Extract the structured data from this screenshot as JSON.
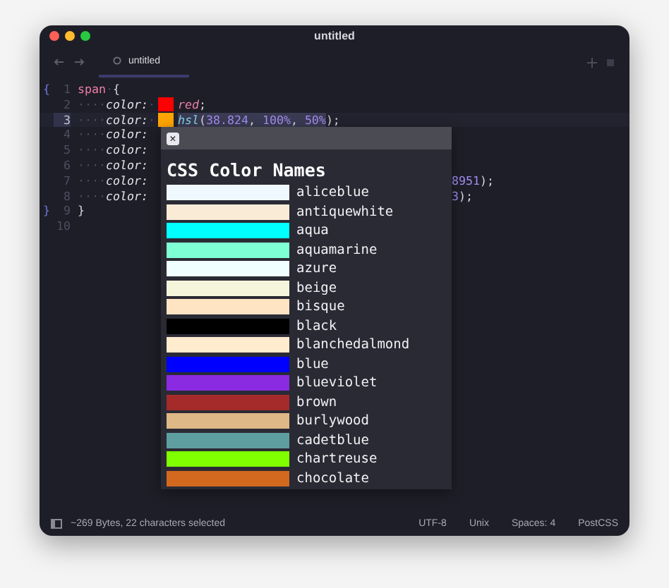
{
  "window": {
    "title": "untitled"
  },
  "tabs": [
    {
      "label": "untitled",
      "selected": true
    }
  ],
  "editor": {
    "lines": [
      {
        "number": "1",
        "fold": "{",
        "current": false,
        "tokens": [
          {
            "kind": "selector",
            "text": "span"
          },
          {
            "kind": "space",
            "text": "·"
          },
          {
            "kind": "punct",
            "text": "{"
          }
        ]
      },
      {
        "number": "2",
        "current": false,
        "tokens": [
          {
            "kind": "space",
            "text": "····"
          },
          {
            "kind": "property",
            "text": "color:"
          },
          {
            "kind": "space",
            "text": "·"
          },
          {
            "kind": "swatch",
            "color": "#ff0000"
          },
          {
            "kind": "value",
            "text": "red"
          },
          {
            "kind": "punct",
            "text": ";"
          }
        ]
      },
      {
        "number": "3",
        "current": true,
        "tokens": [
          {
            "kind": "space",
            "text": "····"
          },
          {
            "kind": "property",
            "text": "color:"
          },
          {
            "kind": "space",
            "text": "·"
          },
          {
            "kind": "swatch",
            "color": "#ffa500"
          },
          {
            "kind": "selection",
            "tokens": [
              {
                "kind": "func",
                "text": "hsl"
              },
              {
                "kind": "punct",
                "text": "("
              },
              {
                "kind": "number",
                "text": "38.824"
              },
              {
                "kind": "punct",
                "text": ", "
              },
              {
                "kind": "number",
                "text": "100%"
              },
              {
                "kind": "punct",
                "text": ", "
              },
              {
                "kind": "number",
                "text": "50%"
              }
            ]
          },
          {
            "kind": "punct",
            "text": ");"
          }
        ]
      },
      {
        "number": "4",
        "current": false,
        "tokens": [
          {
            "kind": "space",
            "text": "····"
          },
          {
            "kind": "property",
            "text": "color:"
          }
        ]
      },
      {
        "number": "5",
        "current": false,
        "tokens": [
          {
            "kind": "space",
            "text": "····"
          },
          {
            "kind": "property",
            "text": "color:"
          }
        ]
      },
      {
        "number": "6",
        "current": false,
        "tokens": [
          {
            "kind": "space",
            "text": "····"
          },
          {
            "kind": "property",
            "text": "color:"
          }
        ]
      },
      {
        "number": "7",
        "current": false,
        "tokens": [
          {
            "kind": "space",
            "text": "····"
          },
          {
            "kind": "property",
            "text": "color:"
          },
          {
            "kind": "gap"
          },
          {
            "kind": "number",
            "text": "8951"
          },
          {
            "kind": "punct",
            "text": ");"
          }
        ]
      },
      {
        "number": "8",
        "current": false,
        "tokens": [
          {
            "kind": "space",
            "text": "····"
          },
          {
            "kind": "property",
            "text": "color:"
          },
          {
            "kind": "gap"
          },
          {
            "kind": "number",
            "text": "3"
          },
          {
            "kind": "punct",
            "text": ");"
          }
        ]
      },
      {
        "number": "9",
        "fold": "}",
        "current": false,
        "tokens": [
          {
            "kind": "punct",
            "text": "}"
          }
        ]
      },
      {
        "number": "10",
        "current": false
      }
    ]
  },
  "popup": {
    "close": "×",
    "title": "CSS Color Names",
    "colors": [
      {
        "name": "aliceblue",
        "color": "#f0f8ff"
      },
      {
        "name": "antiquewhite",
        "color": "#faebd7"
      },
      {
        "name": "aqua",
        "color": "#00ffff"
      },
      {
        "name": "aquamarine",
        "color": "#7fffd4"
      },
      {
        "name": "azure",
        "color": "#f0ffff"
      },
      {
        "name": "beige",
        "color": "#f5f5dc"
      },
      {
        "name": "bisque",
        "color": "#ffe4c4"
      },
      {
        "name": "black",
        "color": "#000000"
      },
      {
        "name": "blanchedalmond",
        "color": "#ffebcd"
      },
      {
        "name": "blue",
        "color": "#0000ff"
      },
      {
        "name": "blueviolet",
        "color": "#8a2be2"
      },
      {
        "name": "brown",
        "color": "#a52a2a"
      },
      {
        "name": "burlywood",
        "color": "#deb887"
      },
      {
        "name": "cadetblue",
        "color": "#5f9ea0"
      },
      {
        "name": "chartreuse",
        "color": "#7fff00"
      },
      {
        "name": "chocolate",
        "color": "#d2691e"
      }
    ]
  },
  "status_bar": {
    "info": "~269 Bytes, 22 characters selected",
    "items": [
      "UTF-8",
      "Unix",
      "Spaces: 4",
      "PostCSS"
    ]
  }
}
